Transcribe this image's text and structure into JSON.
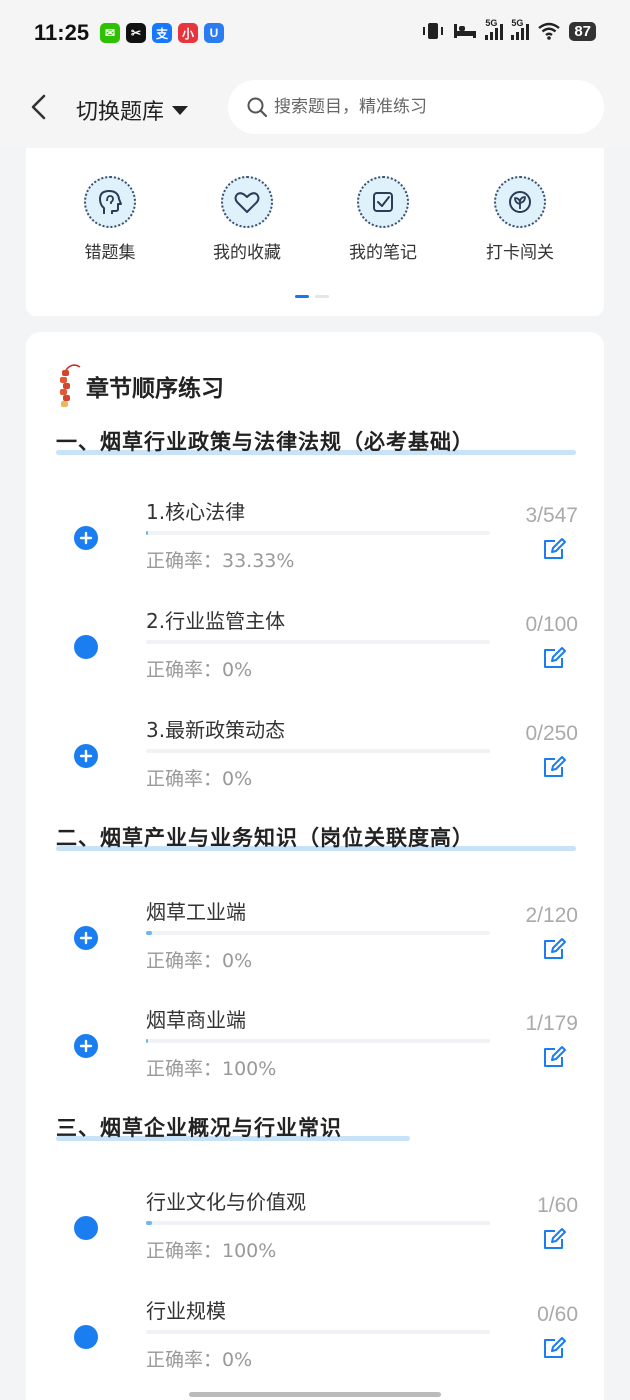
{
  "status_bar": {
    "time": "11:25",
    "apps": [
      {
        "icon": "wechat-icon",
        "color": "#2dc100",
        "glyph": "✉"
      },
      {
        "icon": "capcut-icon",
        "color": "#111111",
        "glyph": "✂"
      },
      {
        "icon": "alipay-icon",
        "color": "#1677ff",
        "glyph": "支"
      },
      {
        "icon": "mini-program-icon",
        "color": "#e8343c",
        "glyph": "小"
      },
      {
        "icon": "shield-app-icon",
        "color": "#2b7bf2",
        "glyph": "U"
      }
    ],
    "signal_labels": [
      "5G",
      "5G"
    ],
    "battery": "87"
  },
  "header": {
    "title": "切换题库",
    "search_placeholder": "搜索题目，精准练习"
  },
  "quick_actions": [
    {
      "label": "错题集",
      "icon": "head-profile-icon"
    },
    {
      "label": "我的收藏",
      "icon": "heart-icon"
    },
    {
      "label": "我的笔记",
      "icon": "note-check-icon"
    },
    {
      "label": "打卡闯关",
      "icon": "leaf-icon"
    }
  ],
  "pager": {
    "pages": 2,
    "active": 1
  },
  "section": {
    "title": "章节顺序练习",
    "icon": "firecracker-icon"
  },
  "chapters": [
    {
      "title": "一、烟草行业政策与法律法规（必考基础）",
      "items": [
        {
          "name": "1.核心法律",
          "rate_label": "正确率：33.33%",
          "count": "3/547",
          "progress": 0.0055,
          "marker": "plus"
        },
        {
          "name": "2.行业监管主体",
          "rate_label": "正确率：0%",
          "count": "0/100",
          "progress": 0,
          "marker": "dot"
        },
        {
          "name": "3.最新政策动态",
          "rate_label": "正确率：0%",
          "count": "0/250",
          "progress": 0,
          "marker": "plus"
        }
      ]
    },
    {
      "title": "二、烟草产业与业务知识（岗位关联度高）",
      "items": [
        {
          "name": "烟草工业端",
          "rate_label": "正确率：0%",
          "count": "2/120",
          "progress": 0.0167,
          "marker": "plus"
        },
        {
          "name": "烟草商业端",
          "rate_label": "正确率：100%",
          "count": "1/179",
          "progress": 0.0056,
          "marker": "plus"
        }
      ]
    },
    {
      "title": "三、烟草企业概况与行业常识",
      "items": [
        {
          "name": "行业文化与价值观",
          "rate_label": "正确率：100%",
          "count": "1/60",
          "progress": 0.0167,
          "marker": "dot"
        },
        {
          "name": "行业规模",
          "rate_label": "正确率：0%",
          "count": "0/60",
          "progress": 0,
          "marker": "dot"
        }
      ]
    }
  ],
  "colors": {
    "accent": "#1a7df0",
    "underline": "#c8e2f8",
    "progress": "#6fb6ee"
  }
}
